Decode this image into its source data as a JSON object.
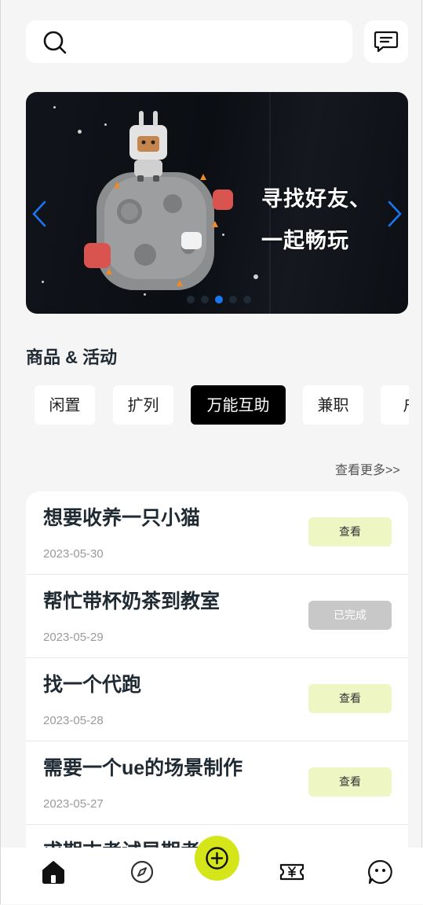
{
  "search": {
    "placeholder": ""
  },
  "banner": {
    "headline_line1": "寻找好友、",
    "headline_line2": "一起畅玩",
    "dot_count": 5,
    "active_dot": 0
  },
  "section": {
    "title": "商品 & 活动"
  },
  "categories": [
    {
      "label": "闲置",
      "active": false
    },
    {
      "label": "扩列",
      "active": false
    },
    {
      "label": "万能互助",
      "active": true
    },
    {
      "label": "兼职",
      "active": false
    },
    {
      "label": "户",
      "active": false
    }
  ],
  "see_more": "查看更多>>",
  "items": [
    {
      "title": "想要收养一只小猫",
      "date": "2023-05-30",
      "action": "查看",
      "status": "open"
    },
    {
      "title": "帮忙带杯奶茶到教室",
      "date": "2023-05-29",
      "action": "已完成",
      "status": "done"
    },
    {
      "title": "找一个代跑",
      "date": "2023-05-28",
      "action": "查看",
      "status": "open"
    },
    {
      "title": "需要一个ue的场景制作",
      "date": "2023-05-27",
      "action": "查看",
      "status": "open"
    },
    {
      "title": "求期末考试早期考",
      "date": "",
      "action": "",
      "status": "open"
    }
  ],
  "nav": [
    "home-icon",
    "compass-icon",
    "add-icon",
    "ticket-icon",
    "chat-face-icon"
  ],
  "colors": {
    "accent": "#d4e51a",
    "chip_active": "#000000",
    "view_button": "#eef6c4",
    "done_button": "#c8c8c8",
    "dot_active": "#1877f2"
  }
}
